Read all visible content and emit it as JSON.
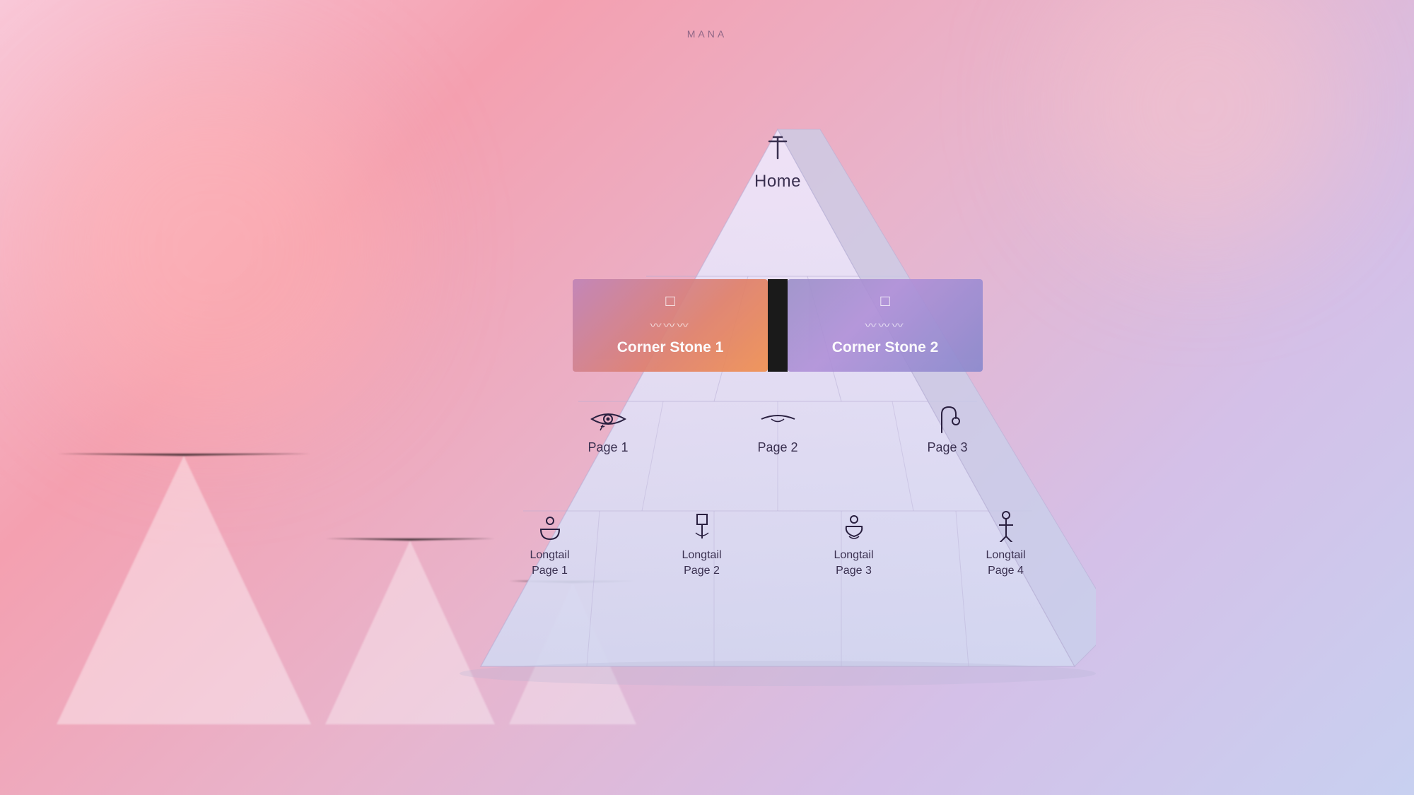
{
  "background": {
    "gradient_start": "#f9c8d8",
    "gradient_end": "#c8d0f0"
  },
  "mana_label": "MANA",
  "pyramid": {
    "tiers": {
      "home": {
        "icon": "⊕",
        "label": "Home"
      },
      "cornerstones": {
        "cs1": {
          "icon": "□",
          "squiggle": "∿∿∿",
          "label": "Corner Stone 1"
        },
        "cs2": {
          "icon": "□",
          "squiggle": "∿∿∿",
          "label": "Corner Stone 2"
        }
      },
      "pages": [
        {
          "icon": "𓂀",
          "label": "Page 1"
        },
        {
          "icon": "◡",
          "label": "Page 2"
        },
        {
          "icon": "𓏭",
          "label": "Page 3"
        }
      ],
      "longtail": [
        {
          "icon": "⊙",
          "label": "Longtail Page 1"
        },
        {
          "icon": "□",
          "label": "Longtail Page 2"
        },
        {
          "icon": "⌂",
          "label": "Longtail Page 3"
        },
        {
          "icon": "♀",
          "label": "Longtail Page 4"
        }
      ]
    }
  }
}
